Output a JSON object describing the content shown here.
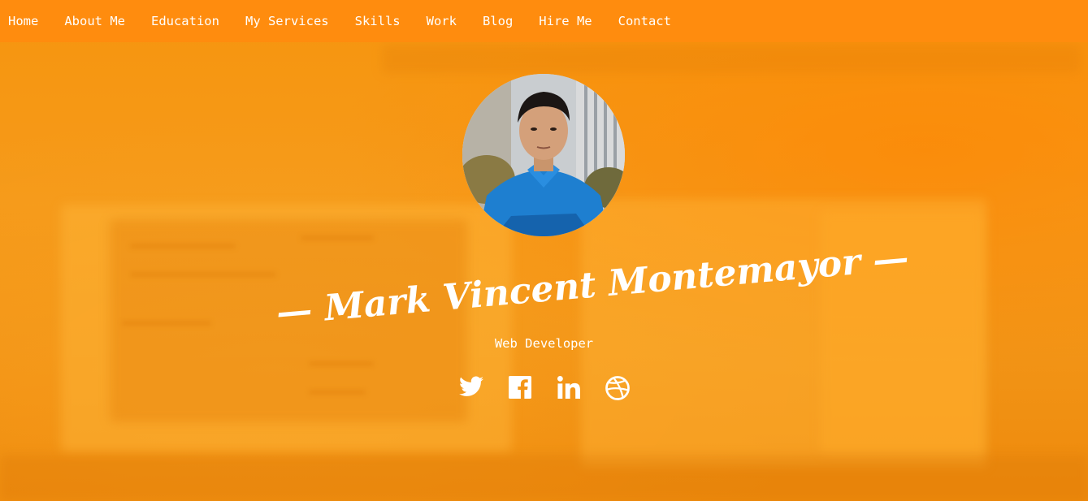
{
  "nav": {
    "items": [
      {
        "label": "Home"
      },
      {
        "label": "About Me"
      },
      {
        "label": "Education"
      },
      {
        "label": "My Services"
      },
      {
        "label": "Skills"
      },
      {
        "label": "Work"
      },
      {
        "label": "Blog"
      },
      {
        "label": "Hire Me"
      },
      {
        "label": "Contact"
      }
    ]
  },
  "hero": {
    "name": "— Mark Vincent Montemayor —",
    "role": "Web Developer",
    "avatar_icon": "profile-photo",
    "social": [
      {
        "icon": "twitter-icon"
      },
      {
        "icon": "facebook-icon"
      },
      {
        "icon": "linkedin-icon"
      },
      {
        "icon": "dribbble-icon"
      }
    ]
  },
  "colors": {
    "nav_bg": "#ff8c0e",
    "hero_bg": "#f59a1a",
    "text": "#ffffff"
  }
}
